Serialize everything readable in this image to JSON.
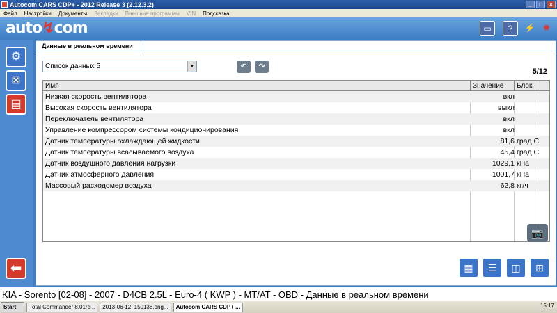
{
  "window": {
    "title": "Autocom CARS CDP+ - 2012 Release 3 (2.12.3.2)",
    "buttons": [
      "_",
      "□",
      "×"
    ]
  },
  "menu": [
    {
      "label": "Файл",
      "enabled": true
    },
    {
      "label": "Настройки",
      "enabled": true
    },
    {
      "label": "Документы",
      "enabled": true
    },
    {
      "label": "Закладки",
      "enabled": false
    },
    {
      "label": "Внешние программы",
      "enabled": false
    },
    {
      "label": "VIN",
      "enabled": false
    },
    {
      "label": "Подсказка",
      "enabled": true
    }
  ],
  "logo": {
    "text_a": "auto",
    "text_b": "com"
  },
  "header_icons": [
    "obd-icon",
    "help-icon",
    "flash-icon",
    "settings-icon"
  ],
  "sidebar": {
    "items": [
      {
        "name": "engine-icon",
        "active": false
      },
      {
        "name": "ecu-icon",
        "active": false
      },
      {
        "name": "realtime-data-icon",
        "active": true
      }
    ],
    "back_icon": "back-arrow-icon"
  },
  "panel": {
    "tab_title": "Данные в реальном времени",
    "select_value": "Список данных 5",
    "page_counter": "5/12"
  },
  "table": {
    "columns": [
      "Имя",
      "Значение",
      "Блок"
    ],
    "rows": [
      {
        "name": "Низкая скорость вентилятора",
        "value": "вкл",
        "unit": ""
      },
      {
        "name": "Высокая скорость вентилятора",
        "value": "выкл",
        "unit": ""
      },
      {
        "name": "Переключатель вентилятора",
        "value": "вкл",
        "unit": ""
      },
      {
        "name": "Управление компрессором системы кондиционирования",
        "value": "вкл",
        "unit": ""
      },
      {
        "name": "Датчик температуры охлаждающей жидкости",
        "value": "81,6",
        "unit": "град.С"
      },
      {
        "name": "Датчик температуры всасываемого воздуха",
        "value": "45,4",
        "unit": "град.С"
      },
      {
        "name": "Датчик воздушного давления нагрузки",
        "value": "1029,1",
        "unit": "кПа"
      },
      {
        "name": "Датчик атмосферного давления",
        "value": "1001,7",
        "unit": "кПа"
      },
      {
        "name": "Массовый расходомер воздуха",
        "value": "62,8",
        "unit": "кг/ч"
      }
    ]
  },
  "status_bar": "KIA - Sorento [02-08] - 2007 - D4CB 2.5L - Euro-4 ( KWP ) - MT/AT - OBD - Данные в реальном времени",
  "taskbar": {
    "start_label": "Start",
    "tasks": [
      {
        "label": "Total Commander 8.01rc...",
        "active": false
      },
      {
        "label": "2013-06-12_150138.png...",
        "active": false
      },
      {
        "label": "Autocom CARS CDP+ ...",
        "active": true
      }
    ],
    "clock": "15:17"
  }
}
